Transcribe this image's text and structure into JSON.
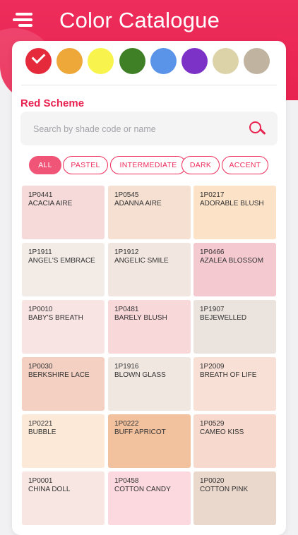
{
  "header": {
    "title": "Color Catalogue",
    "menu_icon": "hamburger-menu-icon",
    "background": "#e8234f"
  },
  "color_filters": {
    "selected_index": 0,
    "check_icon": "check-icon",
    "colors": [
      {
        "name": "red",
        "hex": "#e52a3b"
      },
      {
        "name": "orange",
        "hex": "#eea83a"
      },
      {
        "name": "yellow",
        "hex": "#f8f44d"
      },
      {
        "name": "green",
        "hex": "#3f7f25"
      },
      {
        "name": "blue",
        "hex": "#5994e8"
      },
      {
        "name": "purple",
        "hex": "#7c32c7"
      },
      {
        "name": "cream",
        "hex": "#ddd3a9"
      },
      {
        "name": "taupe",
        "hex": "#c0b3a0"
      }
    ]
  },
  "scheme": {
    "title": "Red Scheme"
  },
  "search": {
    "placeholder": "Search by shade code or name",
    "value": "",
    "icon": "search-icon"
  },
  "tabs": [
    {
      "label": "ALL",
      "active": true
    },
    {
      "label": "PASTEL",
      "active": false
    },
    {
      "label": "INTERMEDIATE",
      "active": false
    },
    {
      "label": "DARK",
      "active": false
    },
    {
      "label": "ACCENT",
      "active": false
    }
  ],
  "shades": [
    {
      "code": "1P0441",
      "name": "ACACIA AIRE",
      "color": "#f6dada"
    },
    {
      "code": "1P0545",
      "name": "ADANNA AIRE",
      "color": "#f6e0d2"
    },
    {
      "code": "1P0217",
      "name": "ADORABLE BLUSH",
      "color": "#fce2c6"
    },
    {
      "code": "1P1911",
      "name": "ANGEL'S EMBRACE",
      "color": "#f3ebe6"
    },
    {
      "code": "1P1912",
      "name": "ANGELIC SMILE",
      "color": "#f1e6e0"
    },
    {
      "code": "1P0466",
      "name": "AZALEA BLOSSOM",
      "color": "#f5c9d0"
    },
    {
      "code": "1P0010",
      "name": "BABY'S BREATH",
      "color": "#f8e4e2"
    },
    {
      "code": "1P0481",
      "name": "BARELY BLUSH",
      "color": "#f8d8d9"
    },
    {
      "code": "1P1907",
      "name": "BEJEWELLED",
      "color": "#ebe3de"
    },
    {
      "code": "1P0030",
      "name": "BERKSHIRE LACE",
      "color": "#f4d0c2"
    },
    {
      "code": "1P1916",
      "name": "BLOWN GLASS",
      "color": "#f1e7e1"
    },
    {
      "code": "1P2009",
      "name": "BREATH OF LIFE",
      "color": "#f8e0d6"
    },
    {
      "code": "1P0221",
      "name": "BUBBLE",
      "color": "#fce9d8"
    },
    {
      "code": "1P0222",
      "name": "BUFF APRICOT",
      "color": "#f2c19e"
    },
    {
      "code": "1P0529",
      "name": "CAMEO KISS",
      "color": "#f7d9cd"
    },
    {
      "code": "1P0001",
      "name": "CHINA DOLL",
      "color": "#f7e6e1"
    },
    {
      "code": "1P0458",
      "name": "COTTON CANDY",
      "color": "#fbd9df"
    },
    {
      "code": "1P0020",
      "name": "COTTON PINK",
      "color": "#ebd8cd"
    }
  ]
}
